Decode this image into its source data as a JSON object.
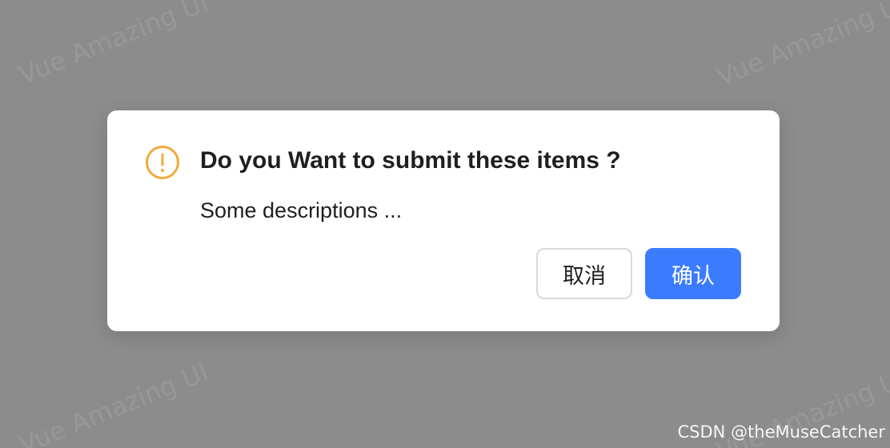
{
  "watermark": {
    "text": "Vue Amazing UI"
  },
  "dialog": {
    "icon": "exclamation-circle-icon",
    "icon_color": "#F2AA3B",
    "title": "Do you Want to submit these items ?",
    "description": "Some descriptions ...",
    "cancel_label": "取消",
    "ok_label": "确认",
    "ok_color": "#3B7CFF"
  },
  "credit": {
    "text": "CSDN @theMuseCatcher"
  }
}
